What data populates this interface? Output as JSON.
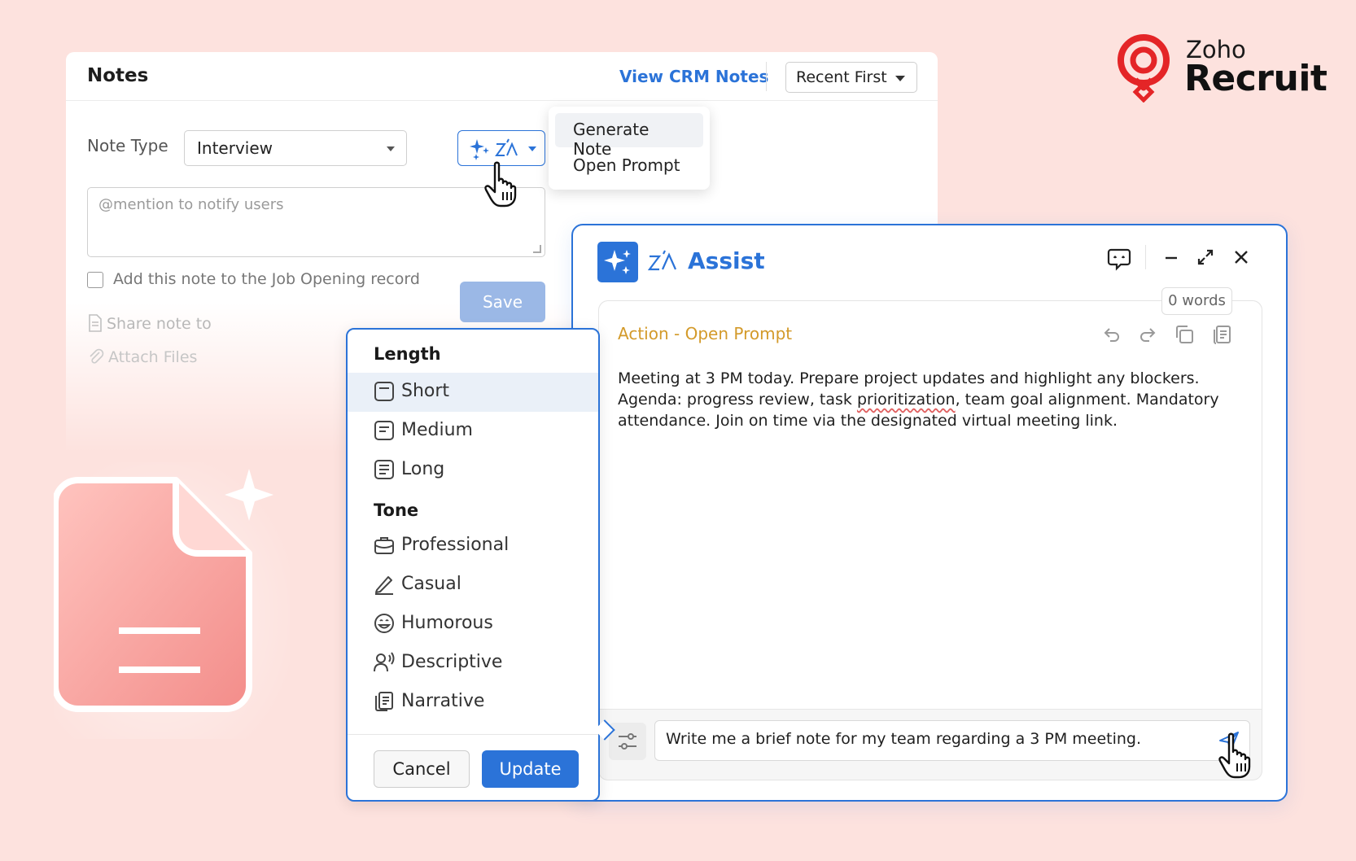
{
  "brand": {
    "line1": "Zoho",
    "line2": "Recruit",
    "color": "#e42527"
  },
  "notes": {
    "title": "Notes",
    "view_crm_label": "View CRM Notes",
    "sort_selected": "Recent First",
    "note_type_label": "Note Type",
    "note_type_value": "Interview",
    "mention_placeholder": "@mention to notify users",
    "job_opening_label": "Add this note to the Job Opening record",
    "save_label": "Save",
    "share_label": "Share note to",
    "attach_label": "Attach Files"
  },
  "zia_menu": {
    "items": [
      {
        "label": "Generate Note"
      },
      {
        "label": "Open Prompt"
      }
    ]
  },
  "assist": {
    "title": "Assist",
    "word_count": "0 words",
    "action_prefix": "Action - ",
    "action_name": "Open Prompt",
    "output_part1": "Meeting at 3 PM today. Prepare project updates and highlight any blockers. Agenda: progress review, task ",
    "output_squiggle": "prioritization",
    "output_part2": ", team goal alignment. Mandatory attendance. Join on time via the designated virtual meeting link.",
    "prompt_value": "Write me a brief note for my team regarding a 3 PM meeting."
  },
  "popover": {
    "length_heading": "Length",
    "length_options": [
      {
        "label": "Short",
        "icon": "short-icon"
      },
      {
        "label": "Medium",
        "icon": "medium-icon"
      },
      {
        "label": "Long",
        "icon": "long-icon"
      }
    ],
    "tone_heading": "Tone",
    "tone_options": [
      {
        "label": "Professional",
        "icon": "briefcase-icon"
      },
      {
        "label": "Casual",
        "icon": "pencil-icon"
      },
      {
        "label": "Humorous",
        "icon": "smile-icon"
      },
      {
        "label": "Descriptive",
        "icon": "speaker-icon"
      },
      {
        "label": "Narrative",
        "icon": "book-icon"
      }
    ],
    "selected_length": "Short",
    "cancel_label": "Cancel",
    "update_label": "Update"
  },
  "colors": {
    "accent": "#2b73d8",
    "background": "#fde2de",
    "action_label": "#d39a2a"
  }
}
